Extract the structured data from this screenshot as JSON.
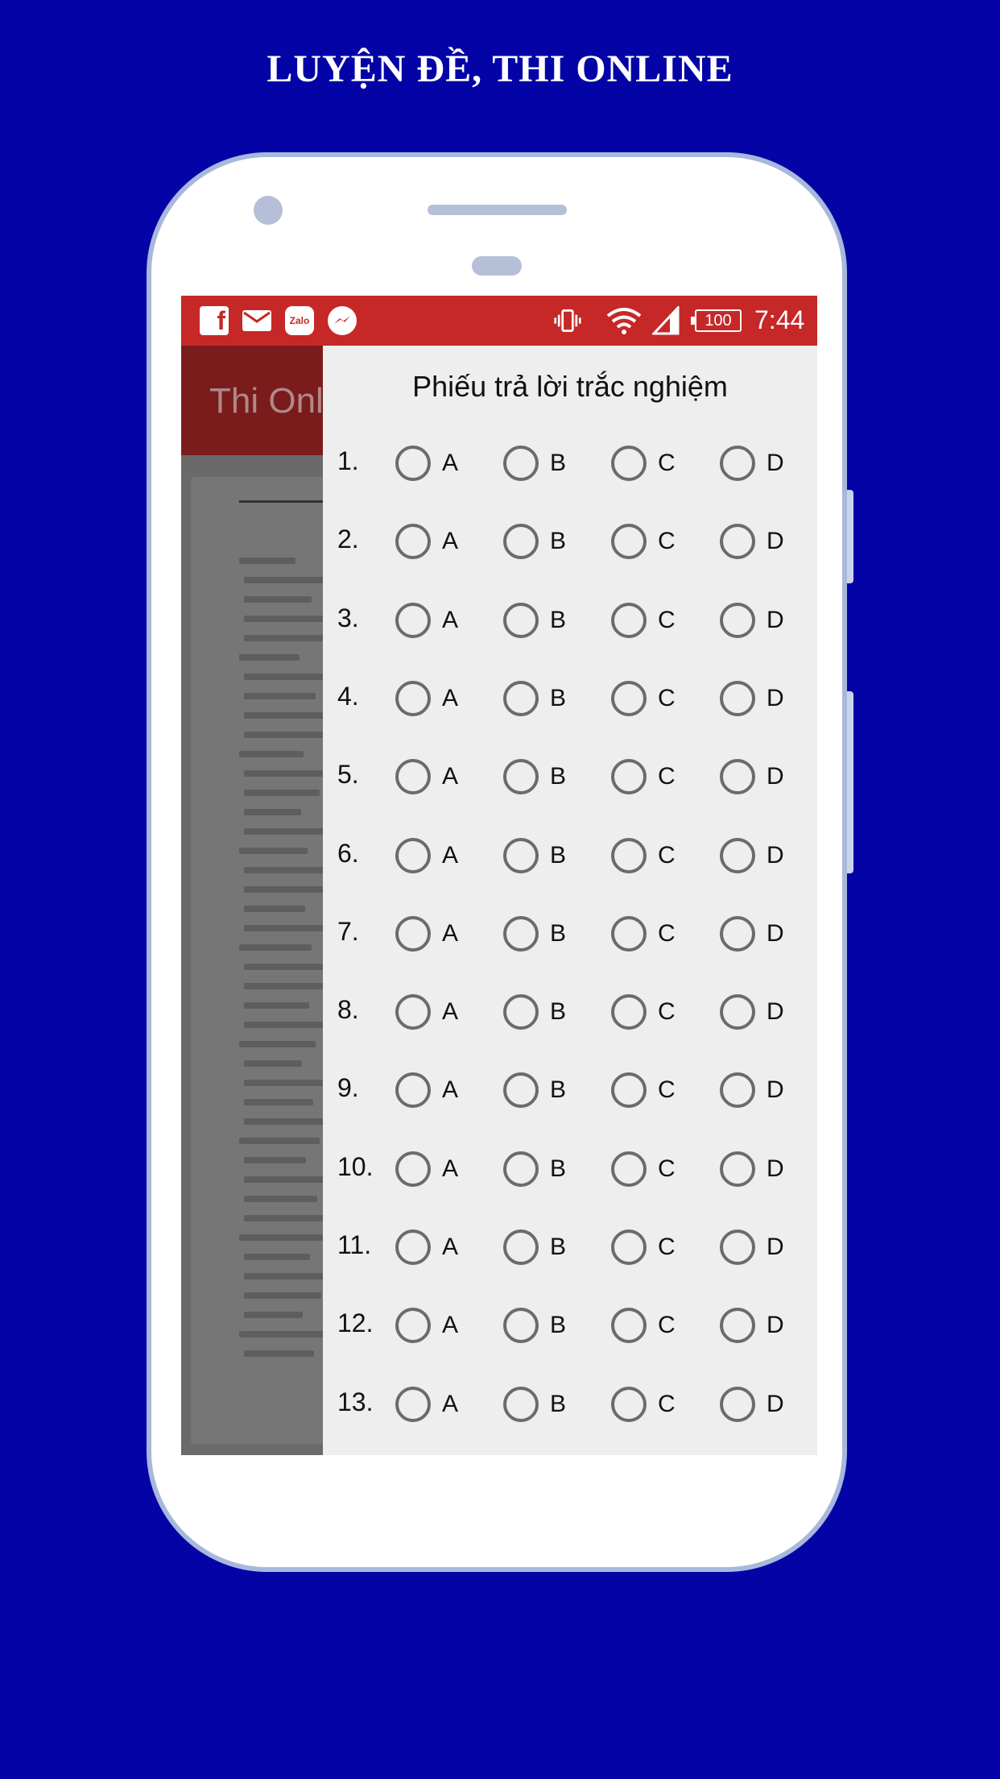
{
  "promo": {
    "title": "LUYỆN ĐỀ, THI ONLINE"
  },
  "status_bar": {
    "notification_icons": [
      "facebook-icon",
      "mail-icon",
      "zalo-icon",
      "messenger-icon"
    ],
    "system_icons": [
      "vibrate-icon",
      "wifi-icon",
      "signal-icon",
      "battery-icon"
    ],
    "battery": "100",
    "time": "7:44"
  },
  "app_bar": {
    "title": "Thi Onl"
  },
  "answer_sheet": {
    "title": "Phiếu trả lời trắc nghiệm",
    "options": [
      "A",
      "B",
      "C",
      "D"
    ],
    "questions": [
      "1.",
      "2.",
      "3.",
      "4.",
      "5.",
      "6.",
      "7.",
      "8.",
      "9.",
      "10.",
      "11.",
      "12.",
      "13."
    ]
  },
  "colors": {
    "background": "#0404a6",
    "status_bar": "#c62828",
    "drawer": "#eeeeee"
  }
}
